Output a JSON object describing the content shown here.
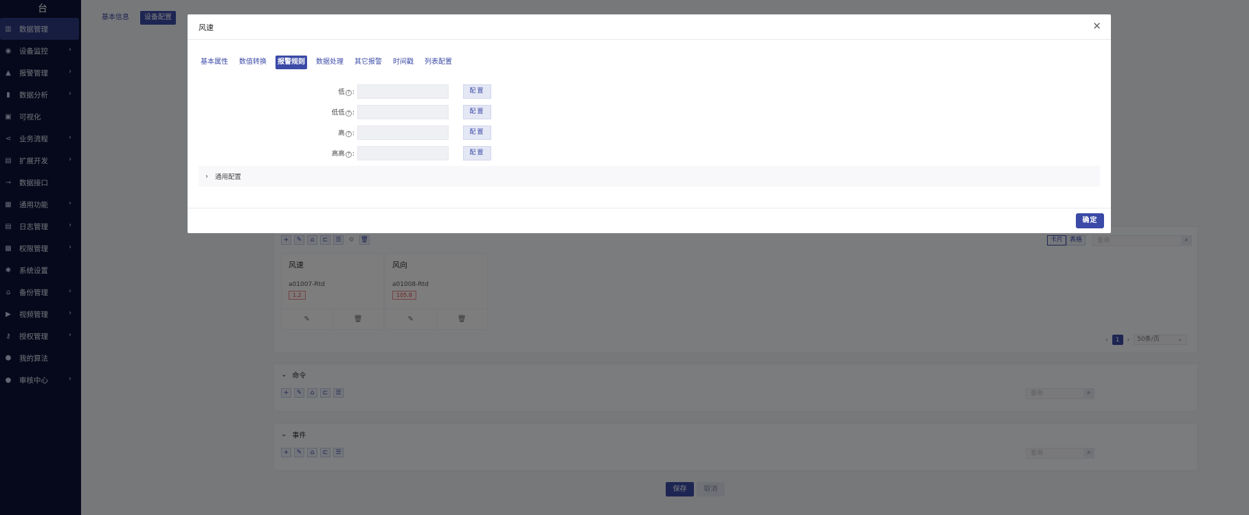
{
  "sidebar": {
    "title": "台",
    "items": [
      {
        "label": "数据管理",
        "icon": "bar-chart-icon",
        "active": true,
        "arrow": false
      },
      {
        "label": "设备监控",
        "icon": "monitor-icon",
        "arrow": true
      },
      {
        "label": "报警管理",
        "icon": "bell-icon",
        "arrow": true
      },
      {
        "label": "数据分析",
        "icon": "analytics-icon",
        "arrow": true
      },
      {
        "label": "可视化",
        "icon": "screen-icon",
        "arrow": false
      },
      {
        "label": "业务流程",
        "icon": "flow-icon",
        "arrow": true
      },
      {
        "label": "扩展开发",
        "icon": "code-icon",
        "arrow": true
      },
      {
        "label": "数据接口",
        "icon": "plug-icon",
        "arrow": false
      },
      {
        "label": "通用功能",
        "icon": "grid-icon",
        "arrow": true
      },
      {
        "label": "日志管理",
        "icon": "log-icon",
        "arrow": true
      },
      {
        "label": "权限管理",
        "icon": "lock-icon",
        "arrow": true
      },
      {
        "label": "系统设置",
        "icon": "gear-icon",
        "arrow": false
      },
      {
        "label": "备份管理",
        "icon": "backup-icon",
        "arrow": true
      },
      {
        "label": "视频管理",
        "icon": "video-icon",
        "arrow": true
      },
      {
        "label": "授权管理",
        "icon": "key-icon",
        "arrow": true
      },
      {
        "label": "我的算法",
        "icon": "algorithm-icon",
        "arrow": false
      },
      {
        "label": "审核中心",
        "icon": "user-icon",
        "arrow": true
      }
    ]
  },
  "main": {
    "tabs": [
      {
        "label": "基本信息",
        "active": false
      },
      {
        "label": "设备配置",
        "active": true
      }
    ],
    "view_toggle": {
      "card": "卡片",
      "table": "表格"
    },
    "search_placeholder": "查询",
    "cards": [
      {
        "title": "风速",
        "code": "a01007-Rtd",
        "value": "1.2"
      },
      {
        "title": "风向",
        "code": "a01008-Rtd",
        "value": "105.8"
      }
    ],
    "pager": {
      "page": "1",
      "size": "50条/页"
    },
    "sections": [
      {
        "label": "命令"
      },
      {
        "label": "事件"
      }
    ],
    "save_label": "保存",
    "cancel_label": "取消"
  },
  "modal": {
    "title": "风速",
    "tabs": [
      {
        "label": "基本属性",
        "active": false
      },
      {
        "label": "数值转换",
        "active": false
      },
      {
        "label": "报警规则",
        "active": true
      },
      {
        "label": "数据处理",
        "active": false
      },
      {
        "label": "其它报警",
        "active": false
      },
      {
        "label": "时间戳",
        "active": false
      },
      {
        "label": "列表配置",
        "active": false
      }
    ],
    "fields": [
      {
        "label": "低",
        "button": "配置"
      },
      {
        "label": "低低",
        "button": "配置"
      },
      {
        "label": "高",
        "button": "配置"
      },
      {
        "label": "高高",
        "button": "配置"
      }
    ],
    "collapse_label": "通用配置",
    "ok_label": "确定"
  },
  "colors": {
    "sidebar_bg": "#0c1237",
    "accent": "#3b4aa6",
    "overlay": "rgba(0,0,0,0.5)"
  }
}
